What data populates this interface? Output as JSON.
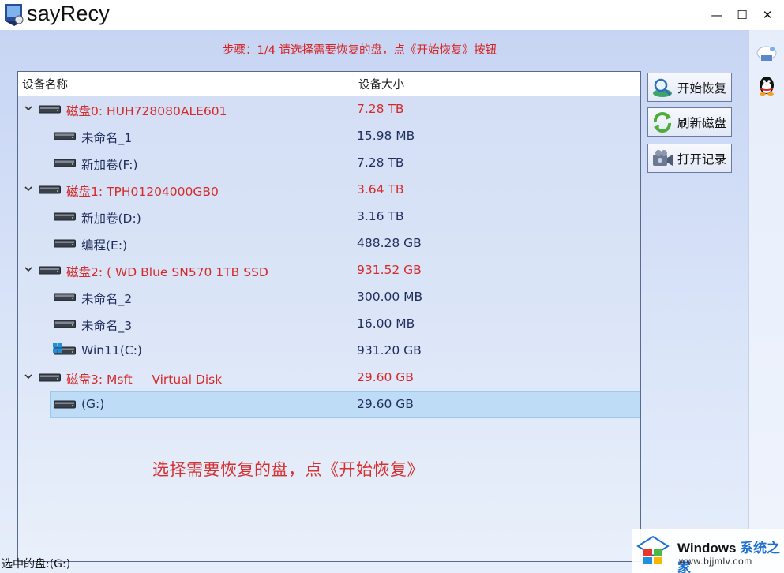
{
  "window": {
    "title": "sayRecy",
    "controls": {
      "minimize": "—",
      "maximize": "☐",
      "close": "✕"
    }
  },
  "step_text": "步骤：1/4 请选择需要恢复的盘，点《开始恢复》按钮",
  "table": {
    "columns": {
      "name": "设备名称",
      "size": "设备大小"
    },
    "rows": [
      {
        "type": "disk",
        "name": "磁盘0: HUH728080ALE601",
        "size": "7.28 TB"
      },
      {
        "type": "part",
        "name": "未命名_1",
        "size": "15.98 MB"
      },
      {
        "type": "part",
        "name": "新加卷(F:)",
        "size": "7.28 TB"
      },
      {
        "type": "disk",
        "name": "磁盘1: TPH01204000GB0",
        "size": "3.64 TB"
      },
      {
        "type": "part",
        "name": "新加卷(D:)",
        "size": "3.16 TB"
      },
      {
        "type": "part",
        "name": "编程(E:)",
        "size": "488.28 GB"
      },
      {
        "type": "disk",
        "name": "磁盘2: ( WD Blue SN570 1TB SSD",
        "size": "931.52 GB"
      },
      {
        "type": "part",
        "name": "未命名_2",
        "size": "300.00 MB"
      },
      {
        "type": "part",
        "name": "未命名_3",
        "size": "16.00 MB"
      },
      {
        "type": "part",
        "name": "Win11(C:)",
        "size": "931.20 GB",
        "system": true
      },
      {
        "type": "disk",
        "name": "磁盘3: Msft     Virtual Disk",
        "size": "29.60 GB"
      },
      {
        "type": "part",
        "name": "(G:)",
        "size": "29.60 GB",
        "selected": true
      }
    ]
  },
  "hint_text": "选择需要恢复的盘，点《开始恢复》",
  "actions": {
    "start": "开始恢复",
    "refresh": "刷新磁盘",
    "open_log": "打开记录"
  },
  "status": {
    "selected": "选中的盘:(G:)"
  },
  "watermark": {
    "title_a": "Windows ",
    "title_b": "系统之家",
    "url": "www.bjjmlv.com"
  },
  "icons": {
    "app": "app-logo-icon",
    "disk": "hard-drive-icon",
    "expander": "chevron-down-icon",
    "start": "magnifier-disk-icon",
    "refresh": "refresh-arrows-icon",
    "open_log": "camera-recorder-icon",
    "side1": "cloud-network-icon",
    "side2": "qq-penguin-icon",
    "windows": "windows-logo-icon"
  },
  "colors": {
    "disk_text": "#d62a2a",
    "part_text": "#1f2d5c",
    "step_text": "#d62020",
    "selection": "#bfdcf6"
  }
}
